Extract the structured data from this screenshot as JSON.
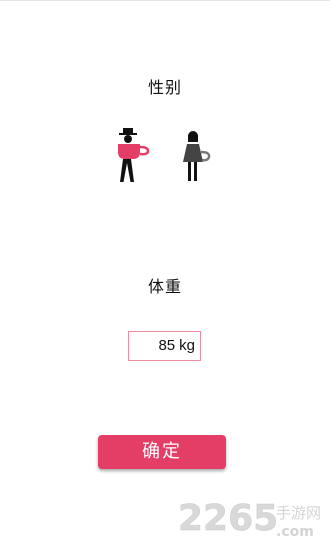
{
  "gender": {
    "title": "性别",
    "options": [
      {
        "icon": "male-figure-icon",
        "color": "#e43d66"
      },
      {
        "icon": "female-figure-icon",
        "color": "#444444"
      }
    ]
  },
  "weight": {
    "title": "体重",
    "value": "85",
    "unit": "kg"
  },
  "confirm_label": "确定",
  "watermark": {
    "number": "2265",
    "site": "手游网",
    "domain": ".com"
  },
  "colors": {
    "accent": "#e43d66",
    "input_border": "#f08aa0"
  }
}
